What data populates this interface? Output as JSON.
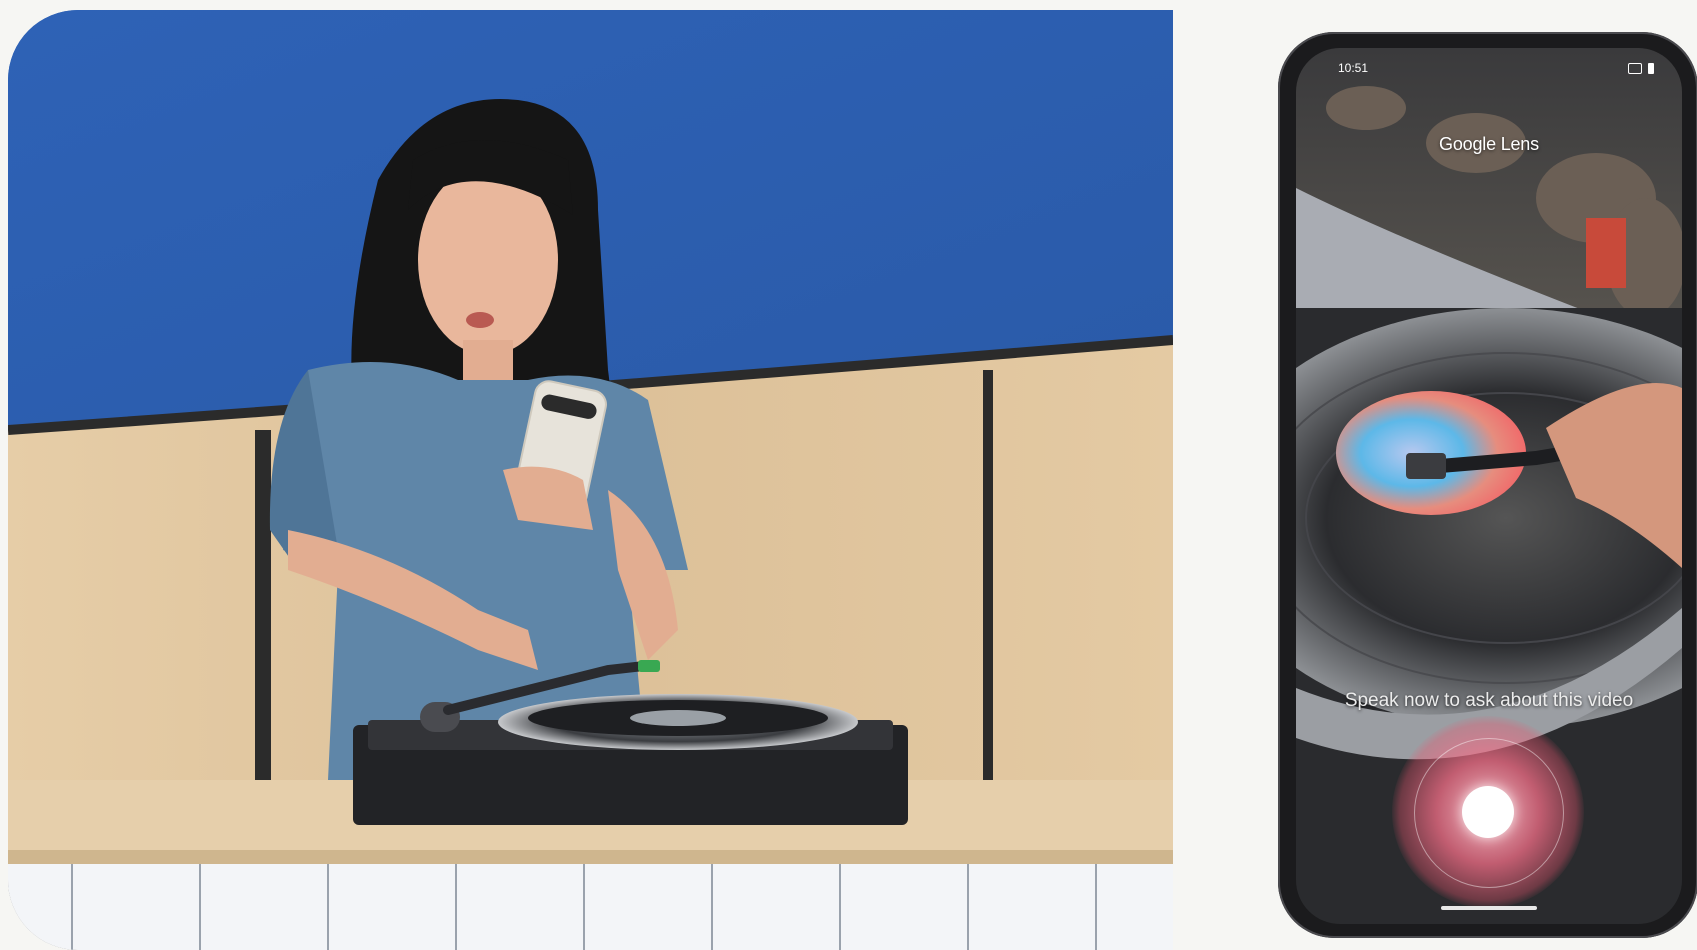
{
  "phone": {
    "status_time": "10:51",
    "app_title": "Google Lens",
    "prompt": "Speak now to ask about this video"
  },
  "colors": {
    "stage_backdrop": "#2f63b8",
    "counter_wood": "#e2c9a2",
    "mic_glow": "#f26e87"
  },
  "icons": [
    "mic-record-icon",
    "signal-icon",
    "battery-icon"
  ]
}
